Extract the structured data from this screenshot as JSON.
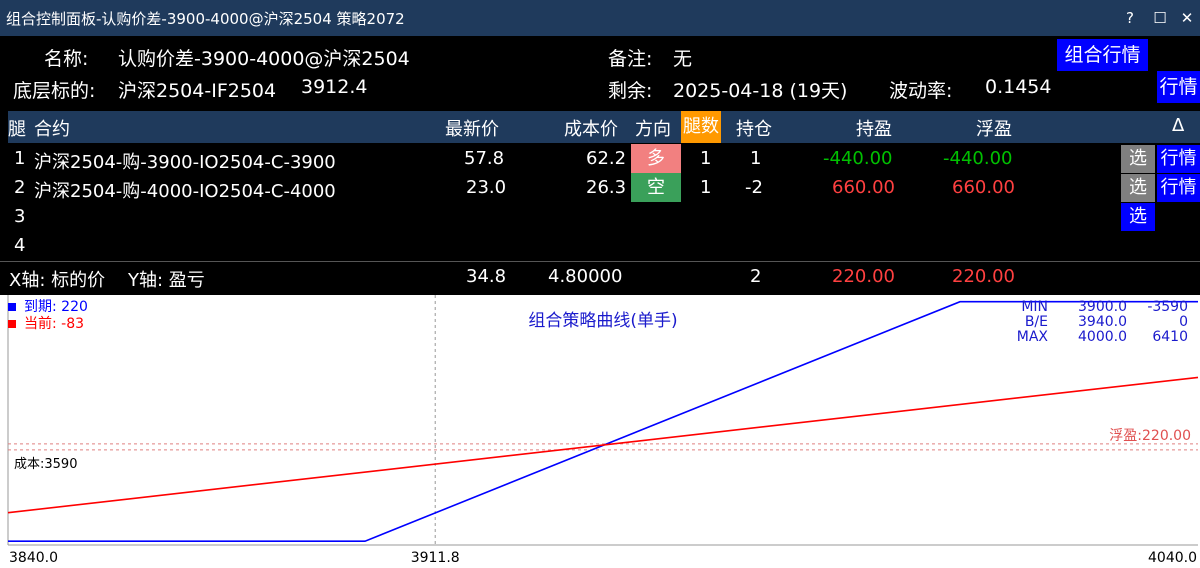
{
  "window": {
    "title": "组合控制面板-认购价差-3900-4000@沪深2504 策略2072",
    "help": "?",
    "maximize": "☐",
    "close": "✕"
  },
  "info": {
    "name_label": "名称:",
    "name_value": "认购价差-3900-4000@沪深2504",
    "underlying_label": "底层标的:",
    "underlying_value": "沪深2504-IF2504",
    "underlying_price": "3912.4",
    "remark_label": "备注:",
    "remark_value": "无",
    "remaining_label": "剩余:",
    "remaining_value": "2025-04-18 (19天)",
    "vol_label": "波动率:",
    "vol_value": "0.1454",
    "combo_quote_button": "组合行情",
    "quote_button": "行情"
  },
  "table": {
    "headers": {
      "leg": "腿",
      "contract": "合约",
      "last": "最新价",
      "cost": "成本价",
      "direction": "方向",
      "lots": "腿数",
      "position": "持仓",
      "pnl": "持盈",
      "float_pnl": "浮盈",
      "delta": "Δ"
    },
    "rows": [
      {
        "leg": "1",
        "contract": "沪深2504-购-3900-IO2504-C-3900",
        "last": "57.8",
        "cost": "62.2",
        "direction": "多",
        "lots": "1",
        "position": "1",
        "pnl": "-440.00",
        "float_pnl": "-440.00",
        "select": "选",
        "quote": "行情"
      },
      {
        "leg": "2",
        "contract": "沪深2504-购-4000-IO2504-C-4000",
        "last": "23.0",
        "cost": "26.3",
        "direction": "空",
        "lots": "1",
        "position": "-2",
        "pnl": "660.00",
        "float_pnl": "660.00",
        "select": "选",
        "quote": "行情"
      },
      {
        "leg": "3",
        "select": "选"
      },
      {
        "leg": "4"
      }
    ],
    "summary": {
      "axis_text": "X轴: 标的价    Y轴: 盈亏",
      "last": "34.8",
      "cost": "4.80000",
      "position": "2",
      "pnl": "220.00",
      "float_pnl": "220.00"
    }
  },
  "chart_data": {
    "type": "line",
    "title": "组合策略曲线(单手)",
    "x_min": 3840.0,
    "x_max": 4040.0,
    "x_ticks": [
      "3840.0",
      "3911.8",
      "4040.0"
    ],
    "crosshair_x": 3911.8,
    "y_min": -3750,
    "y_max": 6690,
    "series": [
      {
        "name": "到期",
        "legend_value": "220",
        "color": "#0000ff",
        "points": [
          [
            3840,
            -3590
          ],
          [
            3900,
            -3590
          ],
          [
            4000,
            6410
          ],
          [
            4040,
            6410
          ]
        ]
      },
      {
        "name": "当前",
        "legend_value": "-83",
        "color": "#ff0000",
        "points": [
          [
            3840,
            -2400
          ],
          [
            4040,
            3250
          ]
        ]
      }
    ],
    "stats": [
      {
        "label": "MIN",
        "x": "3900.0",
        "y": "-3590"
      },
      {
        "label": "B/E",
        "x": "3940.0",
        "y": "0"
      },
      {
        "label": "MAX",
        "x": "4000.0",
        "y": "6410"
      }
    ],
    "float_pnl_label": "浮盈:220.00",
    "float_pnl_value": 220,
    "cost_label": "成本:3590",
    "cost_value": 0
  },
  "colors": {
    "titlebar": "#1f3a5c",
    "header_bg": "#1f3a5c",
    "accent_blue": "#0000ff",
    "long": "#f28080",
    "short": "#3aa05a",
    "profit": "#ff4040",
    "loss": "#00c000"
  }
}
